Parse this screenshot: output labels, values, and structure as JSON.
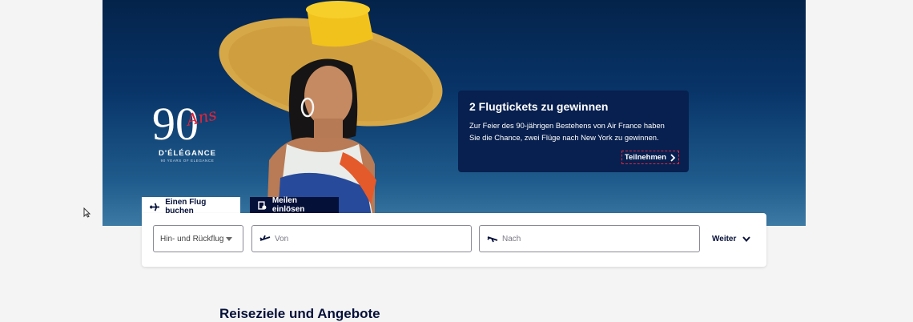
{
  "hero": {
    "logo_number": "90",
    "logo_script": "Ans",
    "logo_subtitle": "D'ÉLÉGANCE",
    "logo_tagline": "90 YEARS OF ELEGANCE"
  },
  "promo": {
    "title": "2 Flugtickets zu gewinnen",
    "text": "Zur Feier des 90-jährigen Bestehens von Air France haben Sie die Chance, zwei Flüge nach New York zu gewinnen.",
    "link_label": "Teilnehmen"
  },
  "tabs": [
    {
      "label": "Einen Flug buchen",
      "icon": "plane-icon",
      "active": true
    },
    {
      "label": "Meilen einlösen",
      "icon": "miles-icon",
      "active": false
    }
  ],
  "search": {
    "trip_type": "Hin- und Rückflug",
    "from_placeholder": "Von",
    "to_placeholder": "Nach",
    "next_label": "Weiter"
  },
  "section": {
    "title": "Reiseziele und Angebote"
  },
  "colors": {
    "navy": "#051039",
    "promo_bg": "#08204f",
    "accent_red": "#e0243a"
  }
}
